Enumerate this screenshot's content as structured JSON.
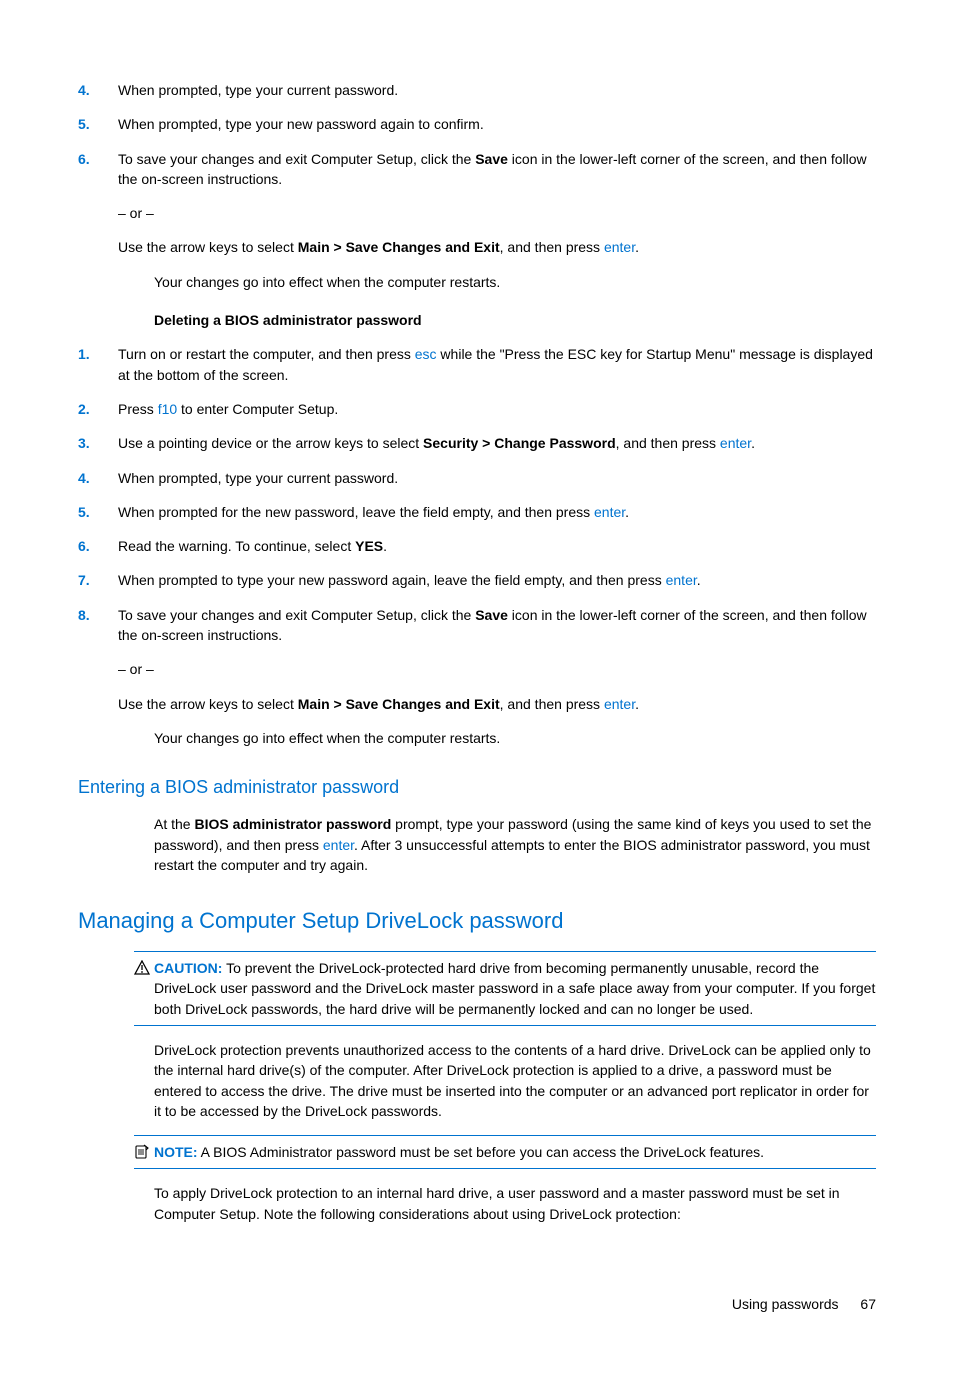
{
  "listA": {
    "items": [
      {
        "num": "4.",
        "text": "When prompted, type your current password."
      },
      {
        "num": "5.",
        "text": "When prompted, type your new password again to confirm."
      },
      {
        "num": "6.",
        "pre": "To save your changes and exit Computer Setup, click the ",
        "b1": "Save",
        "mid": " icon in the lower-left corner of the screen, and then follow the on-screen instructions.",
        "or": "– or –",
        "alt_pre": "Use the arrow keys to select ",
        "alt_b": "Main > Save Changes and Exit",
        "alt_mid": ", and then press ",
        "alt_link": "enter",
        "alt_post": "."
      }
    ],
    "after": "Your changes go into effect when the computer restarts."
  },
  "delHeading": "Deleting a BIOS administrator password",
  "listB": {
    "items": [
      {
        "num": "1.",
        "pre": "Turn on or restart the computer, and then press ",
        "l1": "esc",
        "post": " while the \"Press the ESC key for Startup Menu\" message is displayed at the bottom of the screen."
      },
      {
        "num": "2.",
        "pre": "Press ",
        "l1": "f10",
        "post": " to enter Computer Setup."
      },
      {
        "num": "3.",
        "pre": "Use a pointing device or the arrow keys to select ",
        "b1": "Security > Change Password",
        "mid": ", and then press ",
        "l1": "enter",
        "post": "."
      },
      {
        "num": "4.",
        "text": "When prompted, type your current password."
      },
      {
        "num": "5.",
        "pre": "When prompted for the new password, leave the field empty, and then press ",
        "l1": "enter",
        "post": "."
      },
      {
        "num": "6.",
        "pre": "Read the warning. To continue, select ",
        "b1": "YES",
        "post": "."
      },
      {
        "num": "7.",
        "pre": "When prompted to type your new password again, leave the field empty, and then press ",
        "l1": "enter",
        "post": "."
      },
      {
        "num": "8.",
        "pre": "To save your changes and exit Computer Setup, click the ",
        "b1": "Save",
        "mid": " icon in the lower-left corner of the screen, and then follow the on-screen instructions.",
        "or": "– or –",
        "alt_pre": "Use the arrow keys to select ",
        "alt_b": "Main > Save Changes and Exit",
        "alt_mid": ", and then press ",
        "alt_link": "enter",
        "alt_post": "."
      }
    ],
    "after": "Your changes go into effect when the computer restarts."
  },
  "h3": "Entering a BIOS administrator password",
  "enterPara": {
    "pre": "At the ",
    "b1": "BIOS administrator password",
    "mid1": " prompt, type your password (using the same kind of keys you used to set the password), and then press ",
    "l1": "enter",
    "post": ". After 3 unsuccessful attempts to enter the BIOS administrator password, you must restart the computer and try again."
  },
  "h2": "Managing a Computer Setup DriveLock password",
  "caution": {
    "label": "CAUTION:",
    "text": "   To prevent the DriveLock-protected hard drive from becoming permanently unusable, record the DriveLock user password and the DriveLock master password in a safe place away from your computer. If you forget both DriveLock passwords, the hard drive will be permanently locked and can no longer be used."
  },
  "dlPara": "DriveLock protection prevents unauthorized access to the contents of a hard drive. DriveLock can be applied only to the internal hard drive(s) of the computer. After DriveLock protection is applied to a drive, a password must be entered to access the drive. The drive must be inserted into the computer or an advanced port replicator in order for it to be accessed by the DriveLock passwords.",
  "note": {
    "label": "NOTE:",
    "text": "   A BIOS Administrator password must be set before you can access the DriveLock features."
  },
  "dlPara2": "To apply DriveLock protection to an internal hard drive, a user password and a master password must be set in Computer Setup. Note the following considerations about using DriveLock protection:",
  "footer": {
    "section": "Using passwords",
    "page": "67"
  }
}
